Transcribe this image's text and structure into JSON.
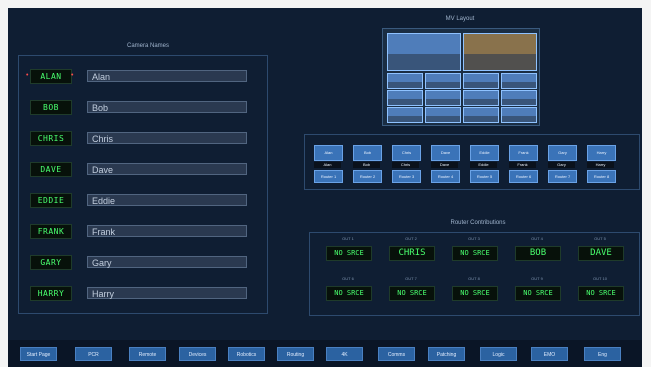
{
  "headings": {
    "camera_names": "Camera Names",
    "mv_layout": "MV Layout",
    "router_contributions": "Router Contributions"
  },
  "cameras": [
    {
      "led": "ALAN",
      "name": "Alan",
      "selected": true
    },
    {
      "led": "BOB",
      "name": "Bob",
      "selected": false
    },
    {
      "led": "CHRIS",
      "name": "Chris",
      "selected": false
    },
    {
      "led": "DAVE",
      "name": "Dave",
      "selected": false
    },
    {
      "led": "EDDIE",
      "name": "Eddie",
      "selected": false
    },
    {
      "led": "FRANK",
      "name": "Frank",
      "selected": false
    },
    {
      "led": "GARY",
      "name": "Gary",
      "selected": false
    },
    {
      "led": "HARRY",
      "name": "Harry",
      "selected": false
    }
  ],
  "source_buttons": [
    "Alan",
    "Bob",
    "Chris",
    "Dave",
    "Eddie",
    "Frank",
    "Gary",
    "Harry"
  ],
  "source_labels": [
    "Alan",
    "Bob",
    "Chris",
    "Dave",
    "Eddie",
    "Frank",
    "Gary",
    "Harry"
  ],
  "mv_destinations": [
    "Router 1",
    "Router 2",
    "Router 3",
    "Router 4",
    "Router 5",
    "Router 6",
    "Router 7",
    "Router 8"
  ],
  "router": {
    "row1": [
      {
        "dest": "OUT 1",
        "source": "NO SRCE"
      },
      {
        "dest": "OUT 2",
        "source": "CHRIS"
      },
      {
        "dest": "OUT 3",
        "source": "NO SRCE"
      },
      {
        "dest": "OUT 4",
        "source": "BOB"
      },
      {
        "dest": "OUT 5",
        "source": "DAVE"
      }
    ],
    "row2": [
      {
        "dest": "OUT 6",
        "source": "NO SRCE"
      },
      {
        "dest": "OUT 7",
        "source": "NO SRCE"
      },
      {
        "dest": "OUT 8",
        "source": "NO SRCE"
      },
      {
        "dest": "OUT 9",
        "source": "NO SRCE"
      },
      {
        "dest": "OUT 10",
        "source": "NO SRCE"
      }
    ]
  },
  "nav": [
    "Start Page",
    "PCR",
    "Remote",
    "Devices",
    "Robotics",
    "Routing",
    "4K",
    "Comms",
    "Patching",
    "Logic",
    "EMO",
    "Eng"
  ],
  "colors": {
    "background": "#0f1e33",
    "led_green": "#49ff6e",
    "button_blue": "#3a73b8",
    "selection_red": "#ff4b4b"
  }
}
